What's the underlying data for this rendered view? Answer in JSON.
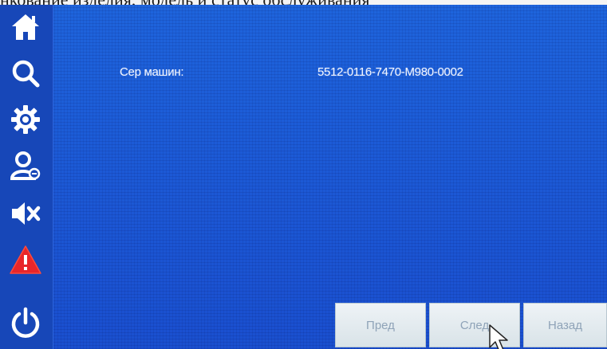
{
  "caption": "нкование изделия, модель и статус обслуживания",
  "sidebar": {
    "items": [
      {
        "icon": "home-icon",
        "name": "home"
      },
      {
        "icon": "search-icon",
        "name": "search"
      },
      {
        "icon": "gear-icon",
        "name": "settings"
      },
      {
        "icon": "user-icon",
        "name": "user"
      },
      {
        "icon": "mute-icon",
        "name": "sound"
      },
      {
        "icon": "warning-icon",
        "name": "alarm"
      },
      {
        "icon": "power-icon",
        "name": "power"
      }
    ]
  },
  "info": {
    "label": "Сер машин:",
    "value": "5512-0116-7470-M980-0002"
  },
  "buttons": {
    "prev": "Пред",
    "next": "След",
    "back": "Назад"
  },
  "colors": {
    "screen_blue": "#1c5ad6",
    "sidebar_blue": "#1747b8",
    "warning_red": "#e8262a",
    "button_bg": "#e4ecf0"
  }
}
